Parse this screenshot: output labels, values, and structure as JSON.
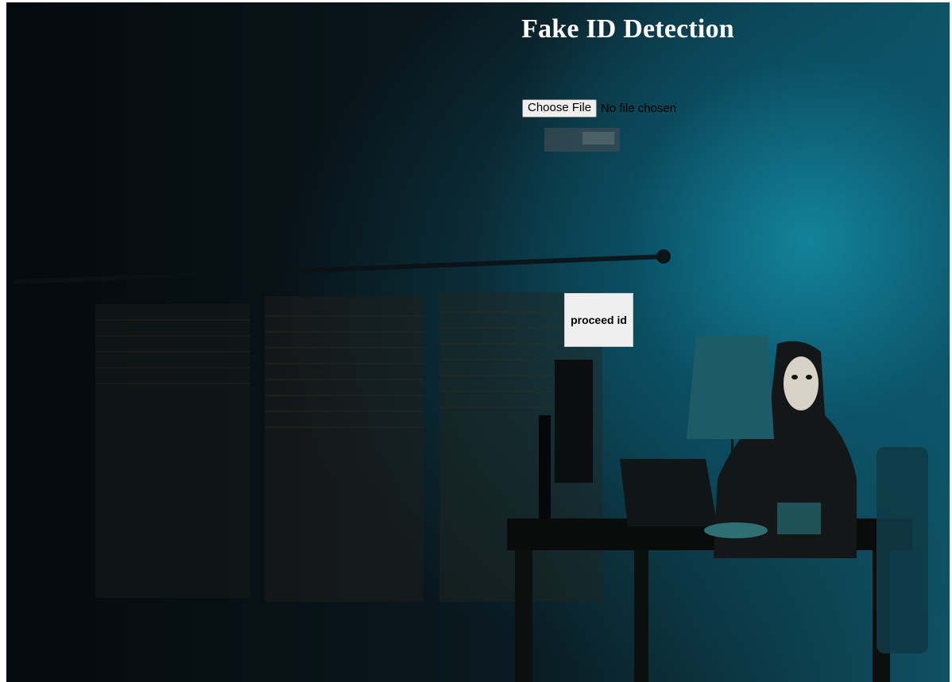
{
  "page": {
    "title": "Fake ID Detection"
  },
  "file_input": {
    "button_label": "Choose File",
    "status": "No file chosen"
  },
  "actions": {
    "proceed_label": "proceed id"
  },
  "colors": {
    "title": "#ffffff",
    "button_bg": "#efefef",
    "accent_teal": "#148ca5"
  }
}
